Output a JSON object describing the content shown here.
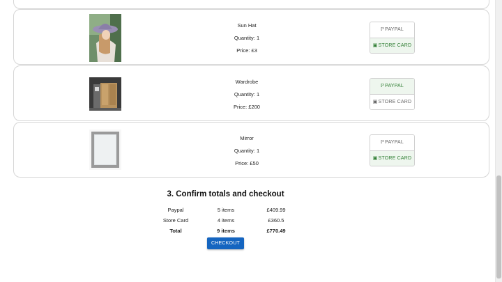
{
  "items": [
    {
      "name": "Sun Hat",
      "quantity": "Quantity: 1",
      "price": "Price: £3",
      "paypal_label": "PAYPAL",
      "store_label": "STORE CARD",
      "selected": "store"
    },
    {
      "name": "Wardrobe",
      "quantity": "Quantity: 1",
      "price": "Price: £200",
      "paypal_label": "PAYPAL",
      "store_label": "STORE CARD",
      "selected": "paypal"
    },
    {
      "name": "Mirror",
      "quantity": "Quantity: 1",
      "price": "Price: £50",
      "paypal_label": "PAYPAL",
      "store_label": "STORE CARD",
      "selected": "store"
    }
  ],
  "checkout": {
    "title": "3. Confirm totals and checkout",
    "rows": [
      {
        "method": "Paypal",
        "items": "5 items",
        "amount": "£409.99"
      },
      {
        "method": "Store Card",
        "items": "4 items",
        "amount": "£360.5"
      },
      {
        "method": "Total",
        "items": "9 items",
        "amount": "£770.49"
      }
    ],
    "button_label": "CHECKOUT"
  },
  "colors": {
    "accent": "#1565c0",
    "selected_green": "#2e7d32"
  },
  "icons": {
    "paypal": "paypal-icon",
    "store_card": "credit-card-icon"
  }
}
